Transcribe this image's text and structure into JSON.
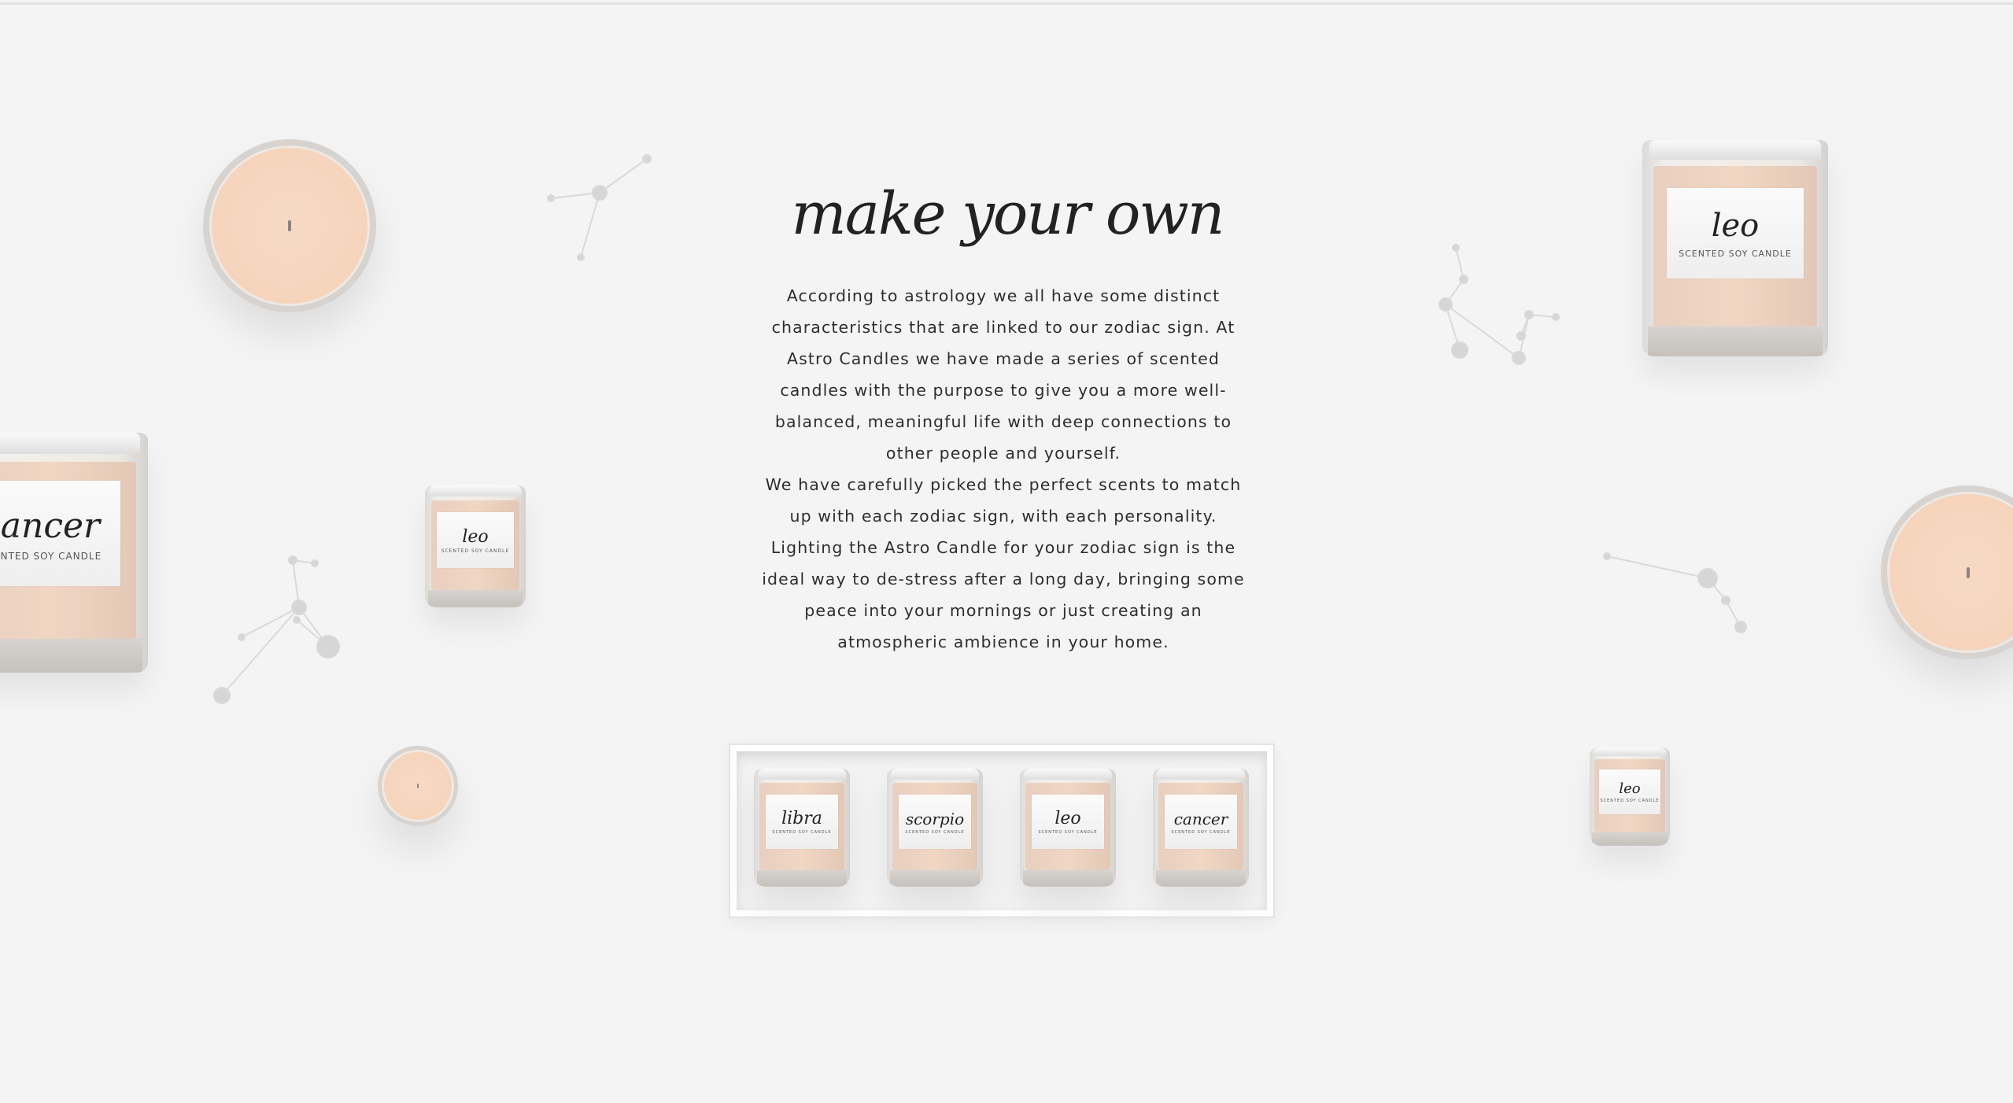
{
  "section": {
    "heading": "make your own",
    "paragraph1": "According to astrology we all have some distinct characteristics that are linked to our zodiac sign. At Astro Candles we have made a series of scented candles with the purpose to give you a more well-balanced, meaningful life with deep connections to other people and yourself.",
    "paragraph2": "We have carefully picked the perfect scents to match up with each zodiac sign, with each personality. Lighting the Astro Candle for your zodiac sign is the ideal way to de-stress after a long day, bringing some peace into your mornings or just creating an atmospheric ambience in your home."
  },
  "candles": {
    "cancer_large": {
      "name": "cancer",
      "subtitle": "SCENTED SOY CANDLE"
    },
    "leo_small_left": {
      "name": "leo",
      "subtitle": "SCENTED SOY CANDLE"
    },
    "leo_large_right": {
      "name": "leo",
      "subtitle": "SCENTED SOY CANDLE"
    },
    "leo_small_right": {
      "name": "leo",
      "subtitle": "SCENTED SOY CANDLE"
    }
  },
  "giftbox": {
    "candles": [
      {
        "name": "libra",
        "subtitle": "SCENTED SOY CANDLE"
      },
      {
        "name": "scorpio",
        "subtitle": "SCENTED SOY CANDLE"
      },
      {
        "name": "leo",
        "subtitle": "SCENTED SOY CANDLE"
      },
      {
        "name": "cancer",
        "subtitle": "SCENTED SOY CANDLE"
      }
    ]
  },
  "colors": {
    "background": "#f4f4f4",
    "wax": "#f6d4bc",
    "text": "#2e2e2e",
    "constellation": "#d6d6d6"
  }
}
